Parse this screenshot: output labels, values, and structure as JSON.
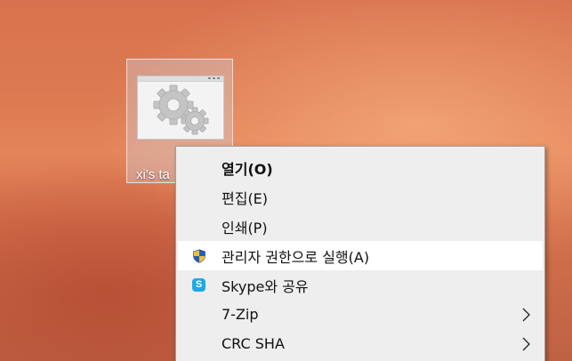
{
  "desktop": {
    "icon": {
      "label": "xi's ta",
      "icon_name": "gear-window-icon"
    }
  },
  "context_menu": {
    "items": [
      {
        "label": "열기(O)",
        "bold": true,
        "icon": null,
        "submenu": false,
        "highlighted": false
      },
      {
        "label": "편집(E)",
        "bold": false,
        "icon": null,
        "submenu": false,
        "highlighted": false
      },
      {
        "label": "인쇄(P)",
        "bold": false,
        "icon": null,
        "submenu": false,
        "highlighted": false
      },
      {
        "label": "관리자 권한으로 실행(A)",
        "bold": false,
        "icon": "uac-shield-icon",
        "submenu": false,
        "highlighted": true
      },
      {
        "label": "Skype와 공유",
        "bold": false,
        "icon": "skype-icon",
        "submenu": false,
        "highlighted": false
      },
      {
        "label": "7-Zip",
        "bold": false,
        "icon": null,
        "submenu": true,
        "highlighted": false
      },
      {
        "label": "CRC SHA",
        "bold": false,
        "icon": null,
        "submenu": true,
        "highlighted": false
      }
    ],
    "skype_icon_letter": "S"
  },
  "colors": {
    "menu_background": "#eeeeee",
    "menu_highlight": "#ffffff",
    "shield_blue": "#1f5fbf",
    "shield_yellow": "#f2c230",
    "skype_blue": "#1ea8e8"
  }
}
